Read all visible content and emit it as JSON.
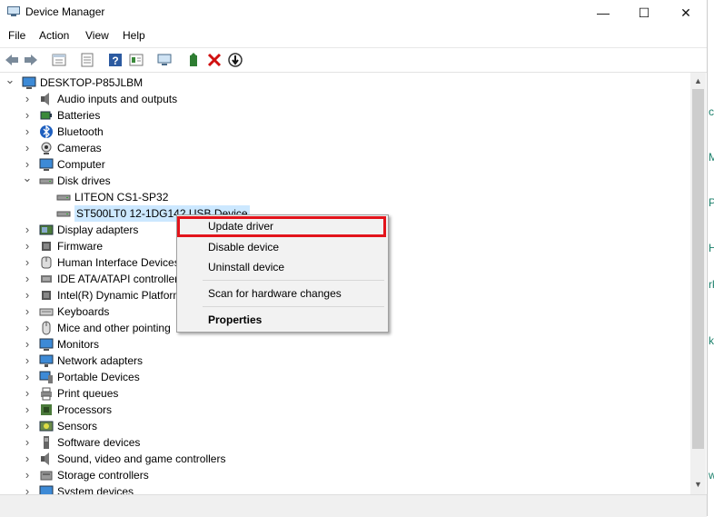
{
  "window": {
    "title": "Device Manager"
  },
  "window_controls": {
    "minimize": "—",
    "maximize": "☐",
    "close": "✕"
  },
  "menu": [
    "File",
    "Action",
    "View",
    "Help"
  ],
  "tree": {
    "root": "DESKTOP-P85JLBM",
    "items": [
      {
        "label": "Audio inputs and outputs",
        "icon": "speaker-icon"
      },
      {
        "label": "Batteries",
        "icon": "battery-icon"
      },
      {
        "label": "Bluetooth",
        "icon": "bluetooth-icon"
      },
      {
        "label": "Cameras",
        "icon": "camera-icon"
      },
      {
        "label": "Computer",
        "icon": "monitor-icon"
      },
      {
        "label": "Disk drives",
        "icon": "disk-icon",
        "expanded": true
      },
      {
        "label": "LITEON CS1-SP32",
        "icon": "disk-icon",
        "child": true
      },
      {
        "label": "ST500LT0 12-1DG142 USB Device",
        "icon": "disk-icon",
        "child": true,
        "selected": true
      },
      {
        "label": "Display adapters",
        "icon": "display-adapter-icon"
      },
      {
        "label": "Firmware",
        "icon": "chip-icon"
      },
      {
        "label": "Human Interface Devices",
        "icon": "hid-icon"
      },
      {
        "label": "IDE ATA/ATAPI controller",
        "icon": "controller-icon"
      },
      {
        "label": "Intel(R) Dynamic Platform",
        "icon": "chip-icon"
      },
      {
        "label": "Keyboards",
        "icon": "keyboard-icon"
      },
      {
        "label": "Mice and other pointing",
        "icon": "mouse-icon"
      },
      {
        "label": "Monitors",
        "icon": "monitor-icon"
      },
      {
        "label": "Network adapters",
        "icon": "network-icon"
      },
      {
        "label": "Portable Devices",
        "icon": "portable-device-icon"
      },
      {
        "label": "Print queues",
        "icon": "printer-icon"
      },
      {
        "label": "Processors",
        "icon": "processor-icon"
      },
      {
        "label": "Sensors",
        "icon": "sensor-icon"
      },
      {
        "label": "Software devices",
        "icon": "software-device-icon"
      },
      {
        "label": "Sound, video and game controllers",
        "icon": "speaker-icon"
      },
      {
        "label": "Storage controllers",
        "icon": "storage-controller-icon"
      },
      {
        "label": "System devices",
        "icon": "monitor-icon"
      }
    ]
  },
  "context_menu": {
    "update": "Update driver",
    "disable": "Disable device",
    "uninstall": "Uninstall device",
    "scan": "Scan for hardware changes",
    "properties": "Properties"
  },
  "right_strip_chars": [
    "ce",
    "M",
    "Pl",
    "H",
    "rk",
    "k",
    "w"
  ],
  "colors": {
    "highlight_box": "#e3141b",
    "selection": "#cce8ff"
  }
}
